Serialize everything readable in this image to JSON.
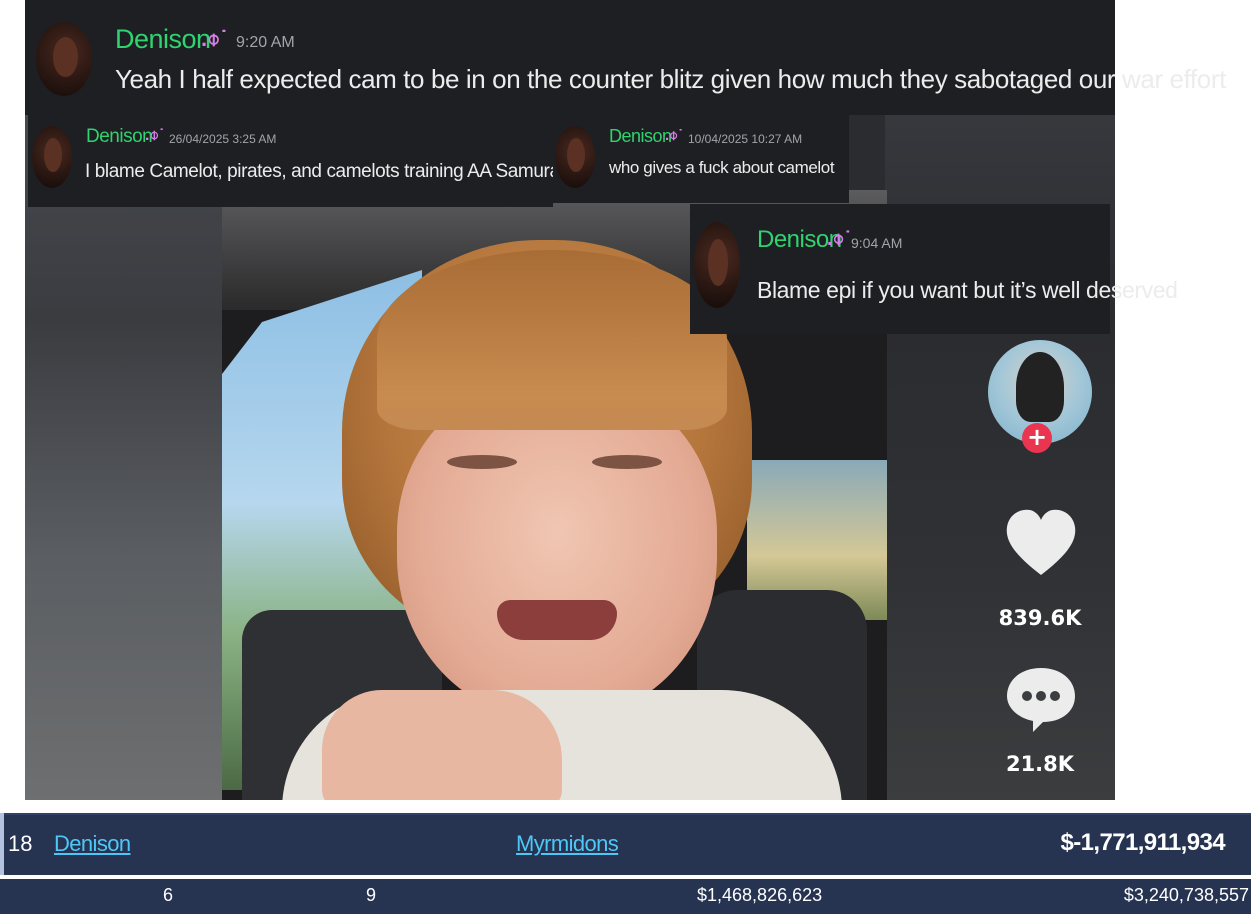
{
  "messages": [
    {
      "username": "Denison",
      "badge": ".⌽˙",
      "timestamp": "9:20 AM",
      "text": "Yeah I half expected cam to be in on the counter blitz given how much they sabotaged our war effort"
    },
    {
      "username": "Denison",
      "badge": ".⌽˙",
      "timestamp": "26/04/2025 3:25 AM",
      "text": "I blame Camelot, pirates, and camelots training AA Samurai as well"
    },
    {
      "username": "Denison",
      "badge": ".⌽˙",
      "timestamp": "10/04/2025 10:27 AM",
      "text": "who gives a fuck about camelot"
    },
    {
      "username": "Denison",
      "badge": ".⌽˙",
      "timestamp": "9:04 AM",
      "text": "Blame epi if you want but it’s well deserved"
    }
  ],
  "tiktok": {
    "follow_symbol": "+",
    "likes": "839.6K",
    "comments": "21.8K",
    "icons": [
      "avatar",
      "plus-icon",
      "heart-icon",
      "comment-icon"
    ],
    "accent": "#ea3551"
  },
  "leaderboard": {
    "row1": {
      "rank": "18",
      "player": "Denison",
      "faction": "Myrmidons",
      "networth": "$-1,771,911,934"
    },
    "row2": {
      "col_a": "6",
      "col_b": "9",
      "col_c": "$1,468,826,623",
      "col_d": "$3,240,738,557"
    },
    "colors": {
      "row_bg": "#263351",
      "link": "#4ec7f6"
    }
  },
  "colors": {
    "discord_bg": "#1e1f23",
    "username": "#2fd36f",
    "badge": "#d87ce8"
  }
}
